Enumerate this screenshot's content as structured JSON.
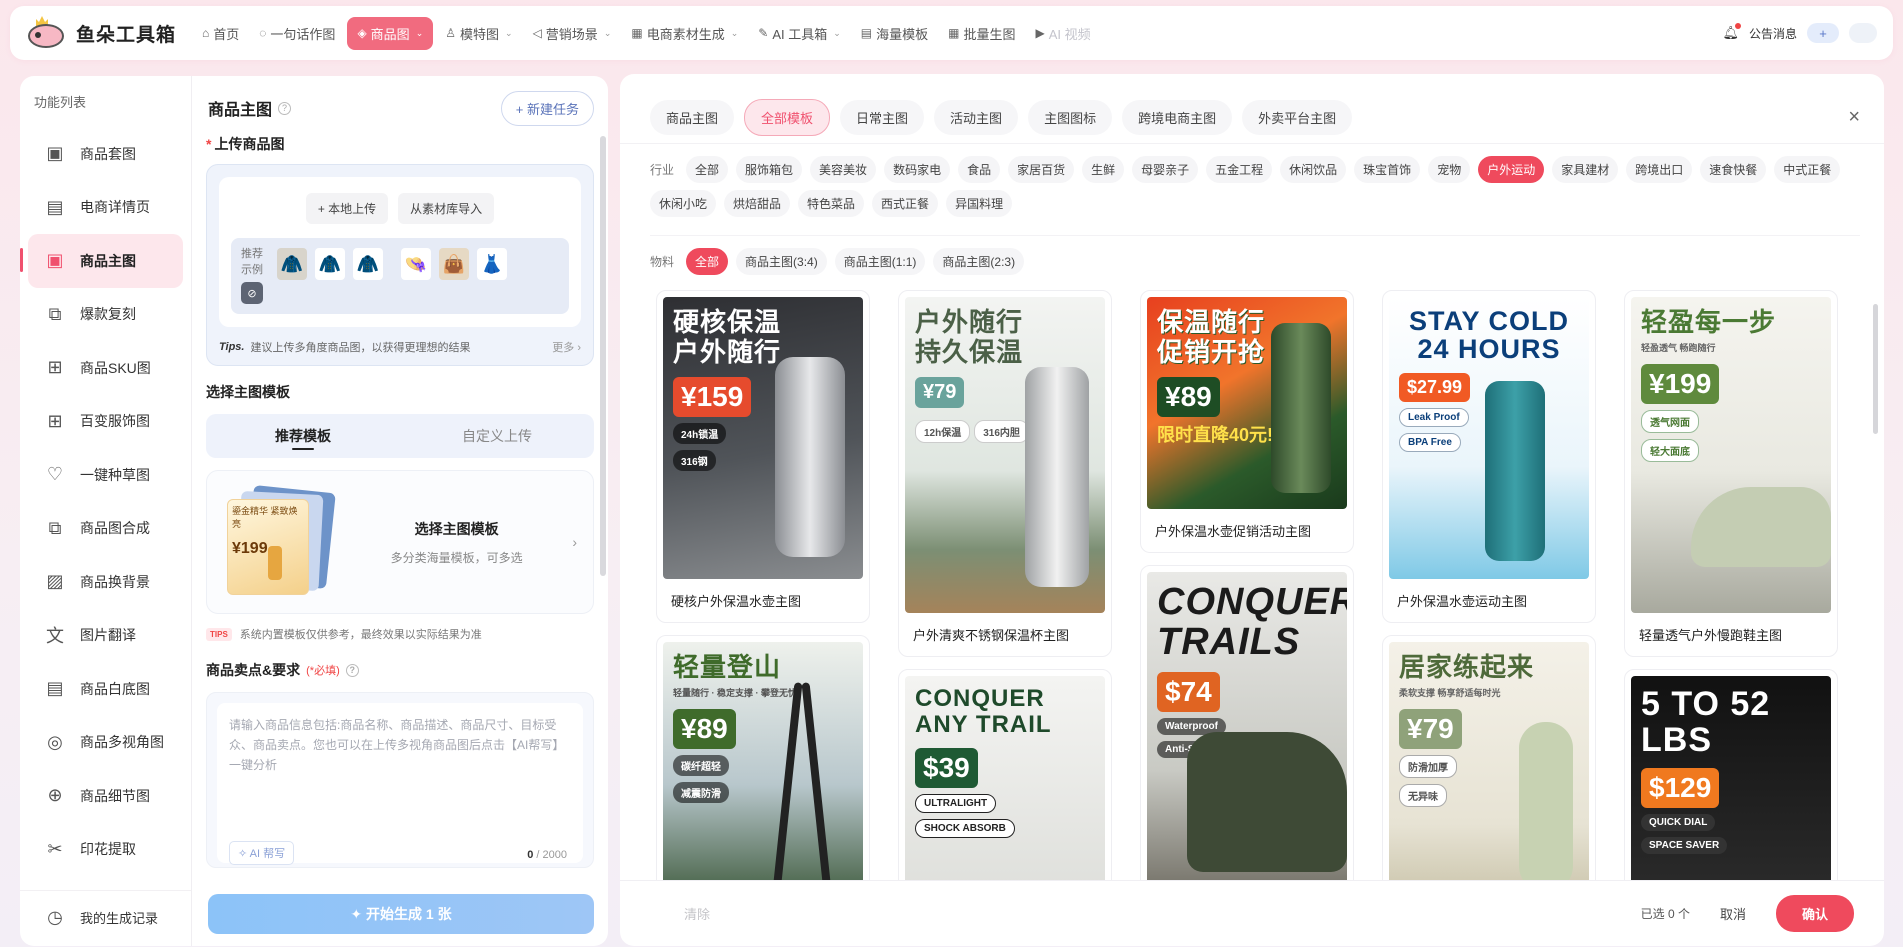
{
  "brand": {
    "name": "鱼朵工具箱"
  },
  "nav": {
    "items": [
      {
        "label": "首页",
        "icon": "home-icon",
        "glyph": "⌂"
      },
      {
        "label": "一句话作图",
        "icon": "chat-icon",
        "glyph": "◌"
      },
      {
        "label": "商品图",
        "icon": "box-icon",
        "glyph": "◈",
        "active": true,
        "dropdown": true
      },
      {
        "label": "模特图",
        "icon": "person-icon",
        "glyph": "♙",
        "dropdown": true
      },
      {
        "label": "营销场景",
        "icon": "megaphone-icon",
        "glyph": "◁",
        "dropdown": true
      },
      {
        "label": "电商素材生成",
        "icon": "grid-icon",
        "glyph": "▦",
        "dropdown": true
      },
      {
        "label": "AI 工具箱",
        "icon": "wand-icon",
        "glyph": "✎",
        "dropdown": true
      },
      {
        "label": "海量模板",
        "icon": "template-icon",
        "glyph": "▤"
      },
      {
        "label": "批量生图",
        "icon": "batch-icon",
        "glyph": "▦"
      },
      {
        "label": "AI 视频",
        "icon": "video-icon",
        "glyph": "▶",
        "disabled": true
      }
    ],
    "announcement": "公告消息",
    "plus": "+"
  },
  "sidebar": {
    "title": "功能列表",
    "items": [
      {
        "label": "商品套图",
        "icon": "image-icon",
        "glyph": "▣"
      },
      {
        "label": "电商详情页",
        "icon": "document-icon",
        "glyph": "▤"
      },
      {
        "label": "商品主图",
        "icon": "image-icon",
        "glyph": "▣",
        "active": true
      },
      {
        "label": "爆款复刻",
        "icon": "copy-icon",
        "glyph": "⧉"
      },
      {
        "label": "商品SKU图",
        "icon": "sku-grid-icon",
        "glyph": "⊞"
      },
      {
        "label": "百变服饰图",
        "icon": "grid-icon",
        "glyph": "⊞"
      },
      {
        "label": "一键种草图",
        "icon": "heart-icon",
        "glyph": "♡"
      },
      {
        "label": "商品图合成",
        "icon": "merge-icon",
        "glyph": "⧉"
      },
      {
        "label": "商品换背景",
        "icon": "landscape-icon",
        "glyph": "▨"
      },
      {
        "label": "图片翻译",
        "icon": "translate-icon",
        "glyph": "文"
      },
      {
        "label": "商品白底图",
        "icon": "whitebg-icon",
        "glyph": "▤"
      },
      {
        "label": "商品多视角图",
        "icon": "globe-icon",
        "glyph": "◎"
      },
      {
        "label": "商品细节图",
        "icon": "zoom-icon",
        "glyph": "⊕"
      },
      {
        "label": "印花提取",
        "icon": "extract-icon",
        "glyph": "✂"
      }
    ],
    "footer": "我的生成记录"
  },
  "form": {
    "title": "商品主图",
    "new_task": "+ 新建任务",
    "upload_label": "上传商品图",
    "local_upload": "+ 本地上传",
    "from_library": "从素材库导入",
    "example_label": "推荐示例",
    "tips_title": "Tips.",
    "tips_text": "建议上传多角度商品图，以获得更理想的结果",
    "tips_more": "更多 ›",
    "template_label": "选择主图模板",
    "tab_recommend": "推荐模板",
    "tab_custom": "自定义上传",
    "tpl_title": "选择主图模板",
    "tpl_desc": "多分类海量模板，可多选",
    "tpl_card_sample_text": "鎏金精华 紧致焕亮",
    "tpl_card_sample_price": "¥199",
    "tips_tag": "TIPS",
    "tips2": "系统内置模板仅供参考，最终效果以实际结果为准",
    "sell_label": "商品卖点&要求",
    "sell_required": "(*必填)",
    "placeholder": "请输入商品信息包括:商品名称、商品描述、商品尺寸、目标受众、商品卖点。您也可以在上传多视角商品图后点击【AI帮写】一键分析",
    "ai_write": "AI 帮写",
    "count_num": "0",
    "count_max": "/ 2000",
    "generate": "✦ 开始生成 1 张"
  },
  "gallery": {
    "tabs": [
      "商品主图",
      "全部模板",
      "日常主图",
      "活动主图",
      "主图图标",
      "跨境电商主图",
      "外卖平台主图"
    ],
    "active_tab": 1,
    "industry_label": "行业",
    "industries": [
      "全部",
      "服饰箱包",
      "美容美妆",
      "数码家电",
      "食品",
      "家居百货",
      "生鲜",
      "母婴亲子",
      "五金工程",
      "休闲饮品",
      "珠宝首饰",
      "宠物",
      "户外运动",
      "家具建材",
      "跨境出口",
      "速食快餐",
      "中式正餐",
      "休闲小吃",
      "烘焙甜品",
      "特色菜品",
      "西式正餐",
      "异国料理"
    ],
    "active_industry": 12,
    "material_label": "物料",
    "materials": [
      "全部",
      "商品主图(3:4)",
      "商品主图(1:1)",
      "商品主图(2:3)"
    ],
    "active_material": 0,
    "cards": [
      {
        "title": "硬核户外保温水壶主图",
        "headline": "硬核保温\n户外随行",
        "price": "¥159",
        "badges": [
          "24h锁温",
          "316钢"
        ]
      },
      {
        "title": "户外清爽不锈钢保温杯主图",
        "headline": "户外随行\n持久保温",
        "price": "¥79",
        "badges": [
          "12h保温",
          "316内胆"
        ]
      },
      {
        "title": "户外保温水壶促销活动主图",
        "headline": "保温随行\n促销开抢",
        "price": "¥89",
        "badges": [
          "限时直降40元!"
        ]
      },
      {
        "title": "户外保温水壶运动主图",
        "headline": "STAY COLD\n24 HOURS",
        "price": "$27.99",
        "badges": [
          "Leak Proof",
          "BPA Free"
        ]
      },
      {
        "title": "轻量透气户外慢跑鞋主图",
        "headline": "轻盈每一步",
        "price": "¥199",
        "badges": [
          "轻盈透气 畅跑随行",
          "透气网面",
          "轻大面底"
        ]
      },
      {
        "title": "",
        "headline": "轻量登山",
        "price": "¥89",
        "badges": [
          "轻量随行 · 稳定支撑 · 攀登无忧",
          "碳纤超轻",
          "减震防滑"
        ]
      },
      {
        "title": "",
        "headline": "CONQUER\nANY TRAIL",
        "price": "$39",
        "badges": [
          "ULTRALIGHT",
          "SHOCK ABSORB"
        ]
      },
      {
        "title": "",
        "headline": "CONQUER\nTRAILS",
        "price": "$74",
        "badges": [
          "Waterproof",
          "Anti-Slip"
        ]
      },
      {
        "title": "",
        "headline": "居家练起来",
        "price": "¥79",
        "badges": [
          "柔软支撑 畅享舒适每时光",
          "防滑加厚",
          "无异味"
        ]
      },
      {
        "title": "",
        "headline": "5 TO 52 LBS",
        "price": "$129",
        "badges": [
          "QUICK DIAL",
          "SPACE SAVER"
        ]
      }
    ],
    "clear": "清除",
    "selected": "已选 0 个",
    "cancel": "取消",
    "confirm": "确认"
  }
}
